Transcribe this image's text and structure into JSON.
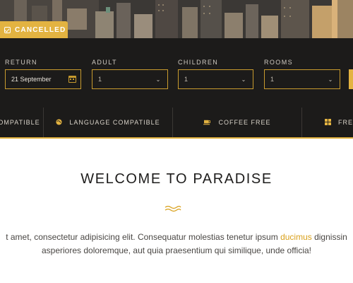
{
  "hero": {
    "cancel_badge_label": "CANCELLED",
    "cancel_badge_icon": "checkbox-icon"
  },
  "booking": {
    "return_label": "RETURN",
    "return_value": "21 September",
    "adult_label": "ADULT",
    "adult_value": "1",
    "children_label": "CHILDREN",
    "children_value": "1",
    "rooms_label": "ROOMS",
    "rooms_value": "1"
  },
  "amenities": [
    {
      "label": "OMPATIBLE",
      "icon": ""
    },
    {
      "label": "LANGUAGE COMPATIBLE",
      "icon": "globe-icon"
    },
    {
      "label": "COFFEE FREE",
      "icon": "coffee-cup-icon"
    },
    {
      "label": "FREE",
      "icon": "windows-icon"
    }
  ],
  "welcome": {
    "title": "WELCOME TO PARADISE",
    "line1_prefix": "t amet, consectetur adipisicing elit. Consequatur molestias tenetur ipsum ",
    "line1_link": "ducimus",
    "line1_suffix": " dignissin",
    "line2": "asperiores doloremque, aut quia praesentium qui similique, unde officia!"
  },
  "colors": {
    "accent": "#e3b341",
    "dark_bar": "#1c1b1a",
    "link": "#d9a01a"
  }
}
